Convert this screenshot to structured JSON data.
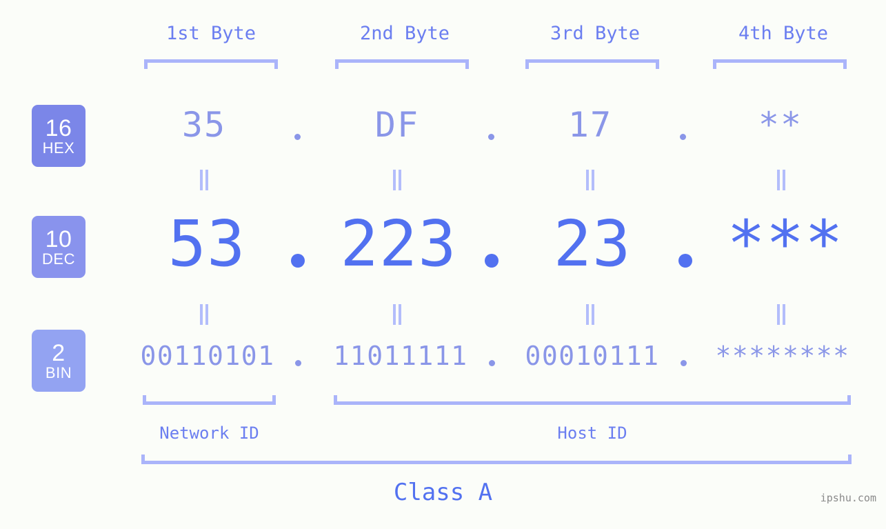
{
  "background_color": "#fbfdf9",
  "accent_color": "#5271f0",
  "bracket_color": "#aab4fa",
  "byte_headers": [
    {
      "label": "1st Byte"
    },
    {
      "label": "2nd Byte"
    },
    {
      "label": "3rd Byte"
    },
    {
      "label": "4th Byte"
    }
  ],
  "radix_rows": [
    {
      "key": "hex",
      "badge_number": "16",
      "badge_name": "HEX",
      "badge_color": "#7b86e8",
      "text_color": "#8a96e8",
      "octets": [
        "35",
        "DF",
        "17",
        "**"
      ],
      "separator": "."
    },
    {
      "key": "dec",
      "badge_number": "10",
      "badge_name": "DEC",
      "badge_color": "#8993ed",
      "text_color": "#5271f0",
      "octets": [
        "53",
        "223",
        "23",
        "***"
      ],
      "separator": "."
    },
    {
      "key": "bin",
      "badge_number": "2",
      "badge_name": "BIN",
      "badge_color": "#93a3f2",
      "text_color": "#8a96e8",
      "octets": [
        "00110101",
        "11011111",
        "00010111",
        "********"
      ],
      "separator": "."
    }
  ],
  "equality_symbol": "=",
  "sections": {
    "network_id_label": "Network ID",
    "host_id_label": "Host ID"
  },
  "class_label": "Class A",
  "watermark": "ipshu.com"
}
